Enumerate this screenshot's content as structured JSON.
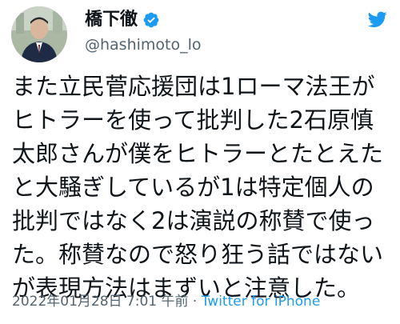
{
  "user": {
    "display_name": "橋下徹",
    "handle": "@hashimoto_lo",
    "verified": true,
    "avatar": "avatar-photo"
  },
  "tweet": {
    "lines": [
      "また立民菅応援団は1ローマ法王が",
      "ヒトラーを使って批判した2石原慎",
      "太郎さんが僕をヒトラーとたとえた",
      "と大騒ぎしているが1は特定個人の",
      "批判ではなく2は演説の称賛で使っ",
      "た。称賛なので怒り狂う話ではない",
      "が表現方法はまずいと注意した。"
    ]
  },
  "meta": {
    "timestamp": "2022年01月28日 7:01 午前",
    "separator": " · ",
    "source": "Twitter for iPhone"
  },
  "icons": {
    "verified": "verified-badge-icon",
    "brand": "twitter-bird-icon"
  },
  "colors": {
    "brand": "#1d9bf0",
    "text": "#0f1419",
    "secondary": "#536471"
  }
}
